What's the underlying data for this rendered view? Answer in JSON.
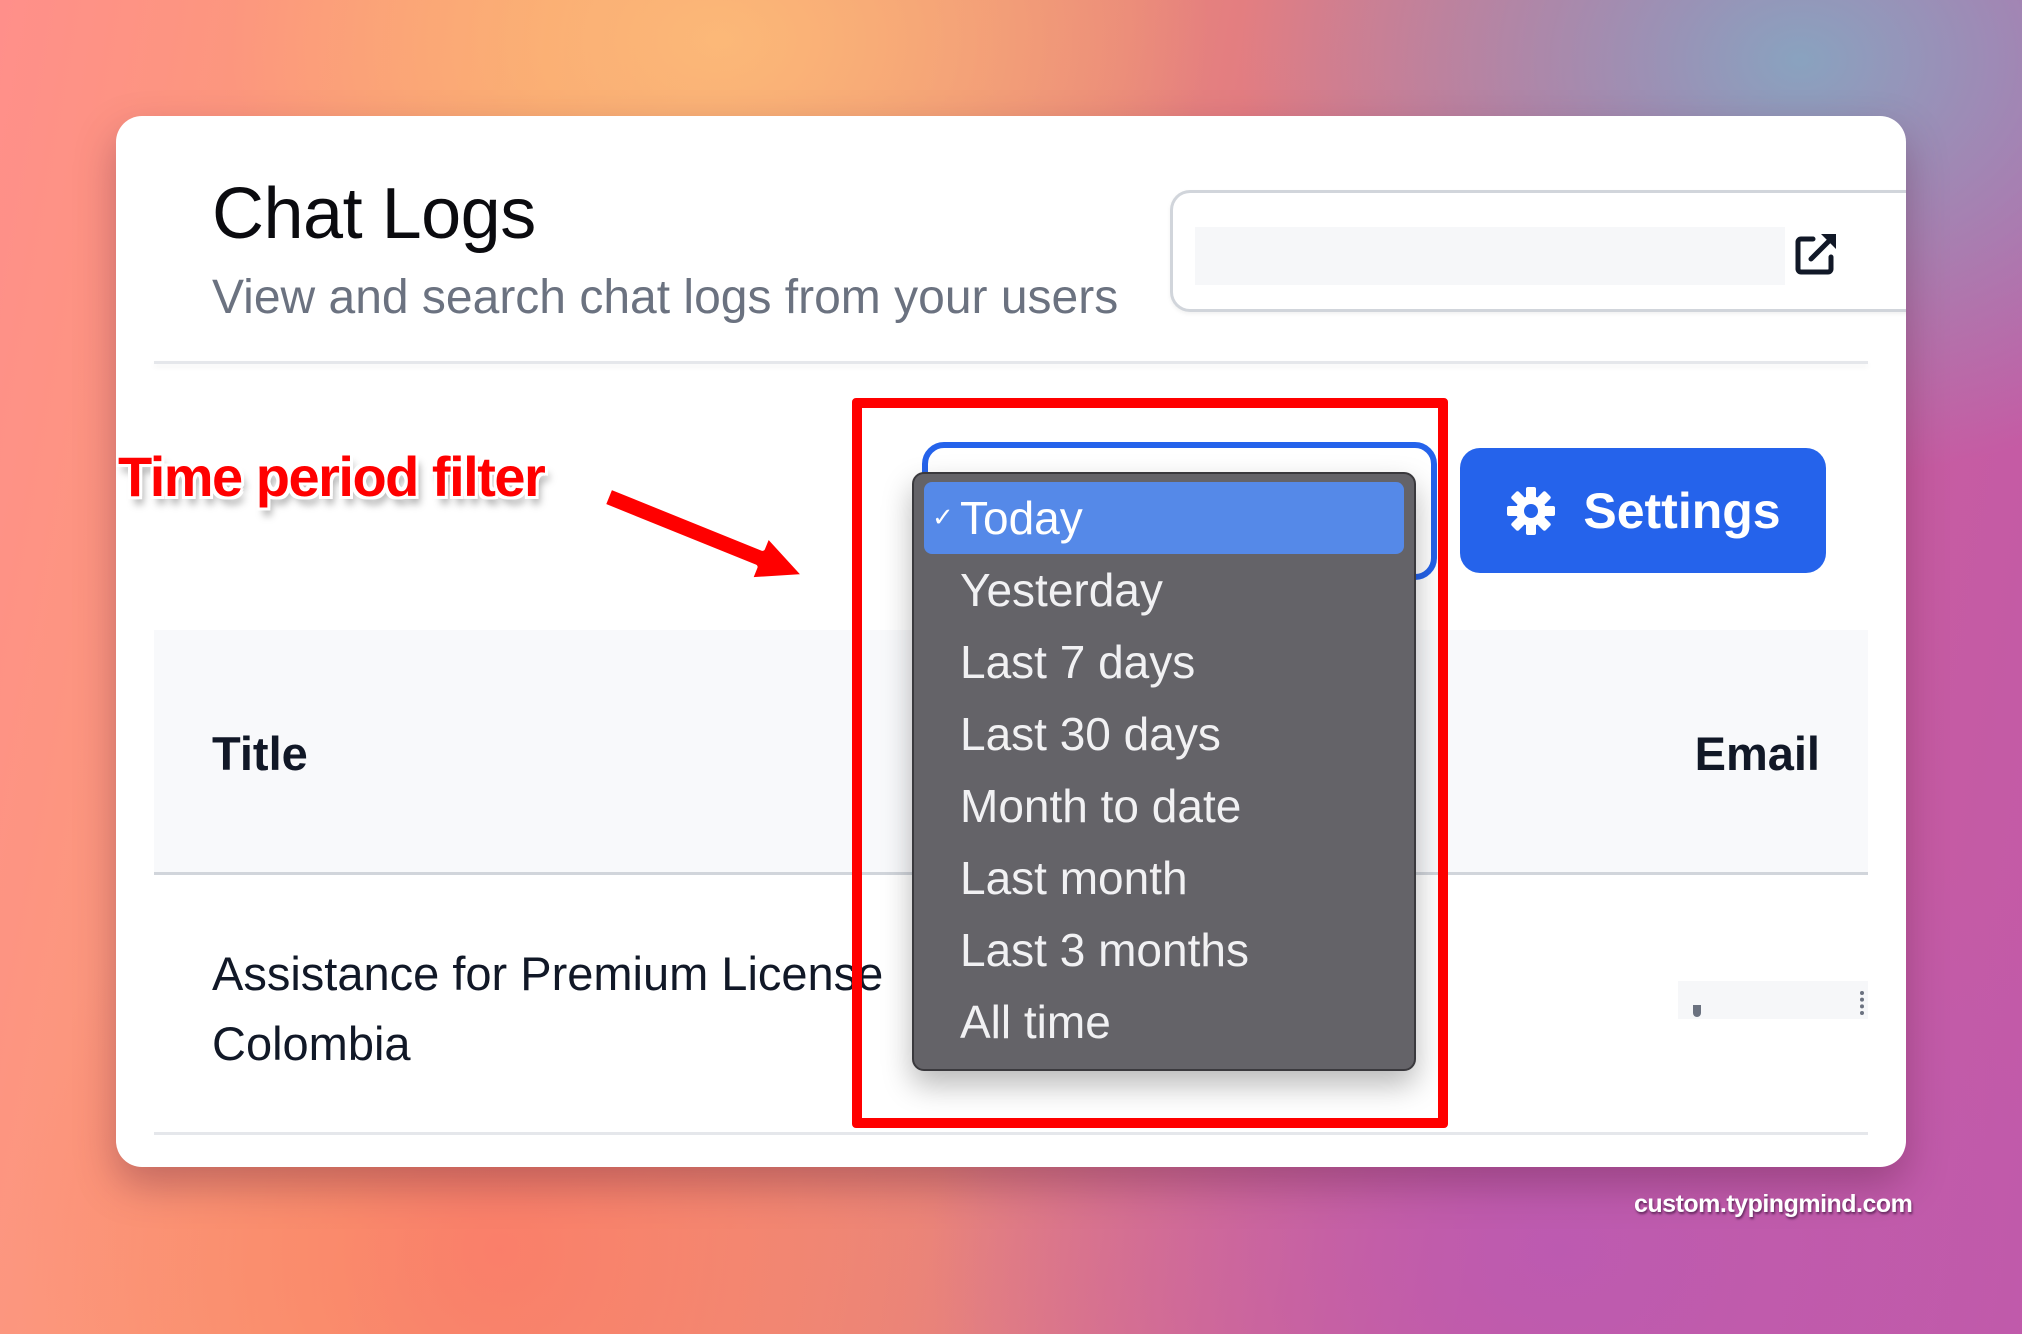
{
  "header": {
    "title": "Chat Logs",
    "subtitle": "View and search chat logs from your users",
    "link_field_value": "",
    "link_icon": "external-link-icon"
  },
  "annotation": {
    "label": "Time period filter",
    "arrow_icon": "arrow-icon",
    "highlight_color": "#ff0000"
  },
  "filter": {
    "selected": "Today",
    "options": [
      {
        "label": "Today",
        "selected": true
      },
      {
        "label": "Yesterday",
        "selected": false
      },
      {
        "label": "Last 7 days",
        "selected": false
      },
      {
        "label": "Last 30 days",
        "selected": false
      },
      {
        "label": "Month to date",
        "selected": false
      },
      {
        "label": "Last month",
        "selected": false
      },
      {
        "label": "Last 3 months",
        "selected": false
      },
      {
        "label": "All time",
        "selected": false
      }
    ],
    "check_glyph": "✓"
  },
  "toolbar": {
    "settings_label": "Settings",
    "settings_icon": "gear-icon",
    "accent_color": "#2563eb"
  },
  "table": {
    "columns": [
      "Title",
      "Email"
    ],
    "rows": [
      {
        "title": "Assistance for Premium License Colombia",
        "email": "(redacted)"
      }
    ]
  },
  "footer": {
    "watermark": "custom.typingmind.com"
  }
}
